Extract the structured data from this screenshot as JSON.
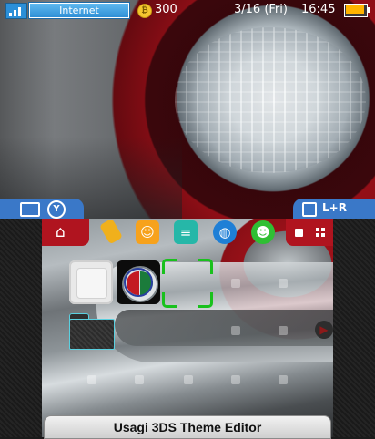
{
  "status_bar": {
    "network": "Internet",
    "coin_symbol": "₿",
    "coin_count": "300",
    "date": "3/16 (Fri)",
    "time": "16:45"
  },
  "top_screen": {
    "left_tab_button": "Y",
    "right_tab_label": "L+R"
  },
  "toolbar": {
    "items": [
      {
        "name": "home-settings-icon",
        "color": "#b0141f"
      },
      {
        "name": "pencil-icon",
        "color": "#f0b01c"
      },
      {
        "name": "smiley-icon",
        "color": "#f7a21c"
      },
      {
        "name": "chat-icon",
        "color": "#26b7a8"
      },
      {
        "name": "globe-icon",
        "color": "#1f7fd6"
      },
      {
        "name": "friends-icon",
        "color": "#2fbf33"
      }
    ],
    "accent_color": "#b0141f"
  },
  "footer": {
    "title": "Usagi 3DS Theme Editor"
  },
  "colors": {
    "tab_blue": "#3a78c8",
    "cursor_green": "#19c11d",
    "battery_orange": "#ffb400"
  }
}
